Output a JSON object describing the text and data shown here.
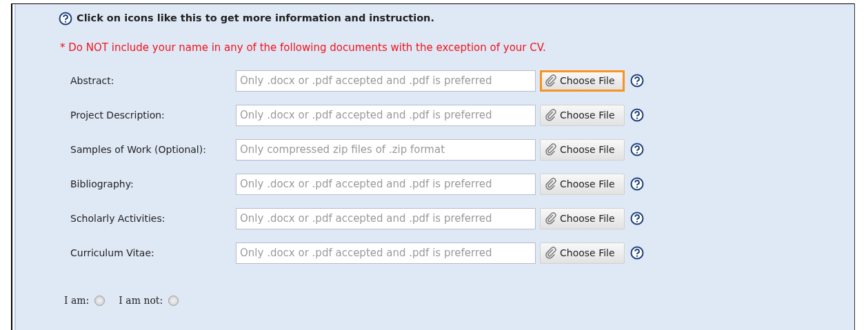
{
  "info": {
    "text": "Click on icons like this to get more information and instruction."
  },
  "warning": "* Do NOT include your name in any of the following documents with the exception of your CV.",
  "uploads": [
    {
      "label": "Abstract:",
      "placeholder": "Only .docx or .pdf accepted and .pdf is preferred",
      "button": "Choose File",
      "highlighted": true
    },
    {
      "label": "Project Description:",
      "placeholder": "Only .docx or .pdf accepted and .pdf is preferred",
      "button": "Choose File",
      "highlighted": false
    },
    {
      "label": "Samples of Work (Optional):",
      "placeholder": "Only compressed zip files of .zip format",
      "button": "Choose File",
      "highlighted": false
    },
    {
      "label": "Bibliography:",
      "placeholder": "Only .docx or .pdf accepted and .pdf is preferred",
      "button": "Choose File",
      "highlighted": false
    },
    {
      "label": "Scholarly Activities:",
      "placeholder": "Only .docx or .pdf accepted and .pdf is preferred",
      "button": "Choose File",
      "highlighted": false
    },
    {
      "label": "Curriculum Vitae:",
      "placeholder": "Only .docx or .pdf accepted and .pdf is preferred",
      "button": "Choose File",
      "highlighted": false
    }
  ],
  "radios": [
    {
      "label": "I am:",
      "selected": false
    },
    {
      "label": "I am not:",
      "selected": false
    }
  ]
}
